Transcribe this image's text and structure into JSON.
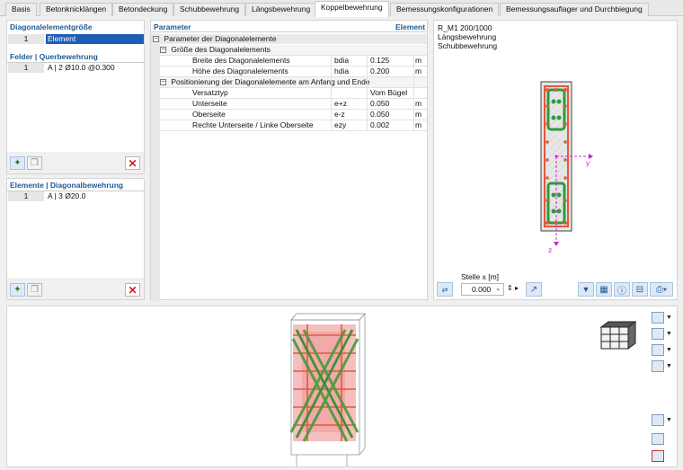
{
  "tabs": [
    "Basis",
    "Betonknicklängen",
    "Betondeckung",
    "Schubbewehrung",
    "Längsbewehrung",
    "Koppelbewehrung",
    "Bemessungskonfigurationen",
    "Bemessungsauflager und Durchbiegung"
  ],
  "left": {
    "size_title": "Diagonalelementgröße",
    "size_rows": [
      {
        "num": "1",
        "label": "Element"
      }
    ],
    "fields_title": "Felder | Querbewehrung",
    "fields_rows": [
      {
        "num": "1",
        "label": "A | 2 Ø10.0 @0.300"
      }
    ],
    "elements_title": "Elemente | Diagonalbewehrung",
    "elements_rows": [
      {
        "num": "1",
        "label": "A | 3 Ø20.0"
      }
    ]
  },
  "params": {
    "col_param": "Parameter",
    "col_element": "Element",
    "group1": "Parameter der Diagonalelemente",
    "sub1": "Größe des Diagonalelements",
    "rows1": [
      {
        "label": "Breite des Diagonalelements",
        "sym": "bdia",
        "value": "0.125",
        "unit": "m"
      },
      {
        "label": "Höhe des Diagonalelements",
        "sym": "hdia",
        "value": "0.200",
        "unit": "m"
      }
    ],
    "sub2": "Positionierung der Diagonalelemente am Anfang und Ende",
    "rows2": [
      {
        "label": "Versatztyp",
        "sym": "",
        "value": "Vom Bügel",
        "unit": ""
      },
      {
        "label": "Unterseite",
        "sym": "e+z",
        "value": "0.050",
        "unit": "m"
      },
      {
        "label": "Oberseite",
        "sym": "e-z",
        "value": "0.050",
        "unit": "m"
      },
      {
        "label": "Rechte Unterseite / Linke Oberseite",
        "sym": "ezy",
        "value": "0.002",
        "unit": "m"
      }
    ]
  },
  "section": {
    "title": "R_M1 200/1000",
    "line2": "Längsbewehrung",
    "line3": "Schubbewehrung",
    "axis_y": "y",
    "axis_z": "z",
    "stelle_label": "Stelle x [m]",
    "stelle_value": "0.000"
  },
  "colors": {
    "accent": "#1e5a96",
    "delete": "#d51e1e",
    "rebar": "#e05a3a",
    "stirrup": "#2e9a3c",
    "axis": "#d020d0"
  }
}
